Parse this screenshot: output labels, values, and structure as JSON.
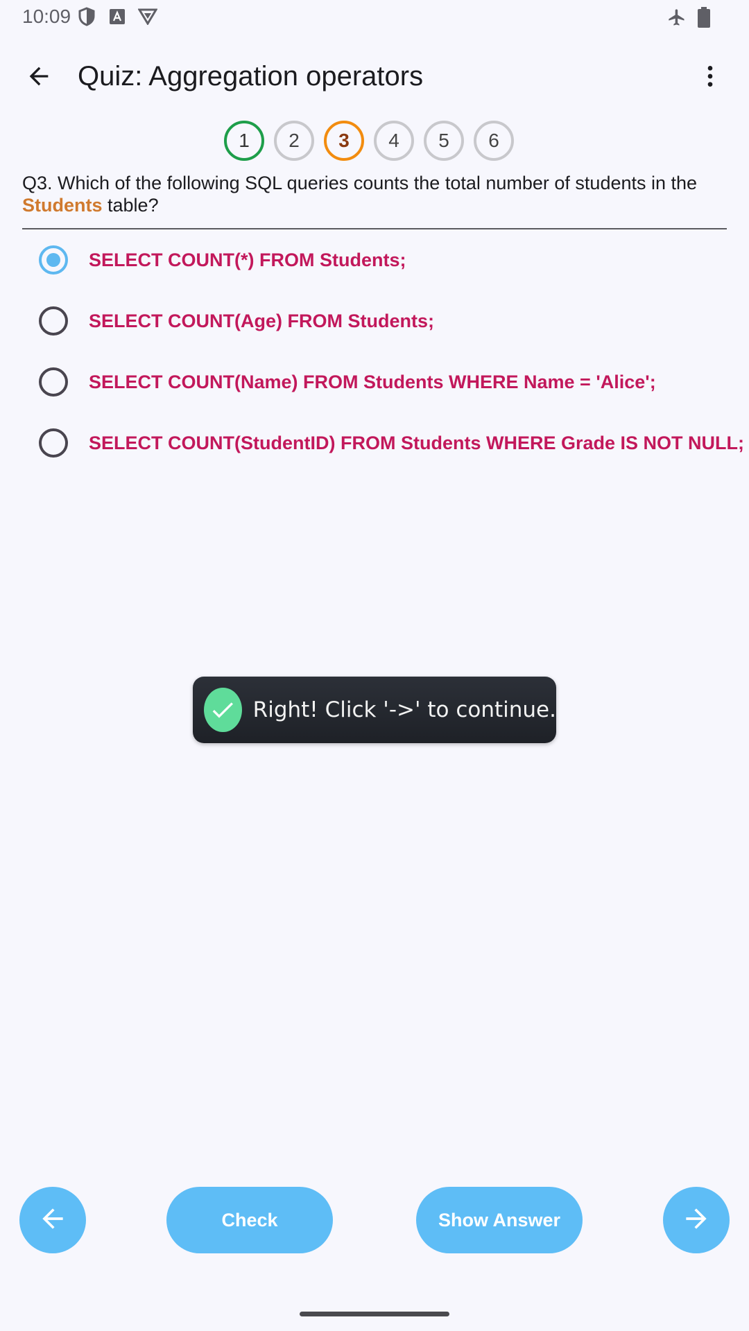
{
  "status_bar": {
    "time": "10:09",
    "left_icons": [
      "shield-icon",
      "font-a-icon",
      "vpn-badge-icon"
    ],
    "right_icons": [
      "airplane-mode-icon",
      "battery-icon"
    ]
  },
  "app_bar": {
    "title": "Quiz: Aggregation operators"
  },
  "stepper": {
    "steps": [
      {
        "label": "1",
        "state": "done"
      },
      {
        "label": "2",
        "state": "pending"
      },
      {
        "label": "3",
        "state": "current"
      },
      {
        "label": "4",
        "state": "pending"
      },
      {
        "label": "5",
        "state": "pending"
      },
      {
        "label": "6",
        "state": "pending"
      }
    ]
  },
  "question": {
    "text_before": "Q3. Which of the following SQL queries counts the total number of students in the ",
    "highlight": "Students",
    "text_after": " table?"
  },
  "options": [
    {
      "label": "SELECT COUNT(*) FROM Students;",
      "selected": true
    },
    {
      "label": "SELECT COUNT(Age) FROM Students;",
      "selected": false
    },
    {
      "label": "SELECT COUNT(Name) FROM Students WHERE Name = 'Alice';",
      "selected": false
    },
    {
      "label": "SELECT COUNT(StudentID) FROM Students WHERE Grade IS NOT NULL;",
      "selected": false
    }
  ],
  "toast": {
    "message": "Right! Click '->' to continue."
  },
  "bottom_bar": {
    "check_label": "Check",
    "show_answer_label": "Show Answer"
  },
  "colors": {
    "accent": "#5ebdf6",
    "option_text": "#c2185b",
    "highlight": "#d07a2e",
    "step_done": "#1e9e4a",
    "step_current": "#f28c0f",
    "toast_success": "#5fdc9a"
  }
}
